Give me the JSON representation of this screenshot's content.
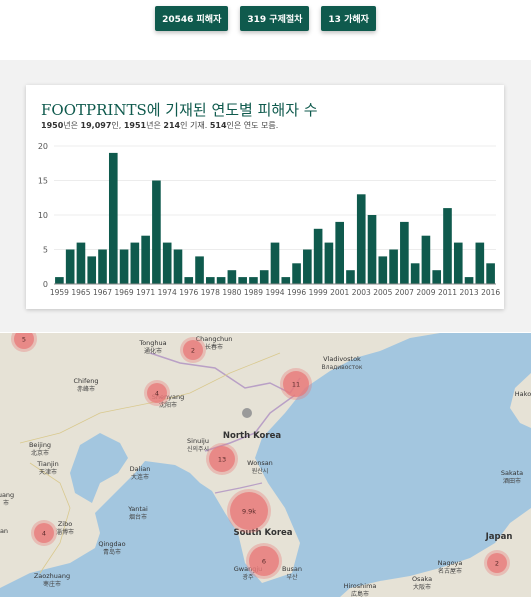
{
  "buttons": [
    {
      "label": "20546 피해자"
    },
    {
      "label": "319 구제절차"
    },
    {
      "label": "13 가해자"
    }
  ],
  "card": {
    "title": "FOOTPRINTS에 기재된 연도별 피해자 수",
    "subtitle": {
      "y1": "1950",
      "t1": "년은 ",
      "v1": "19,097",
      "t2": "인, ",
      "y2": "1951",
      "t3": "년은 ",
      "v2": "214",
      "t4": "인 기재. ",
      "v3": "514",
      "t5": "인은 연도 모름."
    }
  },
  "chart_data": {
    "type": "bar",
    "color": "#0f5a4d",
    "ylim": [
      0,
      20
    ],
    "yticks": [
      0,
      5,
      10,
      15,
      20
    ],
    "x_tick_labels": [
      "1959",
      "1965",
      "1967",
      "1969",
      "1971",
      "1974",
      "1976",
      "1978",
      "1980",
      "1989",
      "1994",
      "1996",
      "1999",
      "2001",
      "2003",
      "2005",
      "2007",
      "2009",
      "2011",
      "2013",
      "2016"
    ],
    "values": [
      1,
      5,
      6,
      4,
      5,
      19,
      5,
      6,
      7,
      15,
      6,
      5,
      1,
      4,
      1,
      1,
      2,
      1,
      1,
      2,
      6,
      1,
      3,
      5,
      8,
      6,
      9,
      2,
      13,
      10,
      4,
      5,
      9,
      3,
      7,
      2,
      11,
      6,
      1,
      6,
      3
    ]
  },
  "map": {
    "labels": [
      {
        "text": "Tonghua",
        "sub": "通化市"
      },
      {
        "text": "Changchun",
        "sub": "长春市"
      },
      {
        "text": "Vladivostok",
        "sub": "Владивосток"
      },
      {
        "text": "Chifeng",
        "sub": "赤峰市"
      },
      {
        "text": "Shenyang",
        "sub": "沈阳市"
      },
      {
        "text": "Beijing",
        "sub": "北京市"
      },
      {
        "text": "Tianjin",
        "sub": "天津市"
      },
      {
        "text": "Dalian",
        "sub": "大连市"
      },
      {
        "text": "Sinuiju",
        "sub": "신의주시"
      },
      {
        "text": "North Korea",
        "sub": ""
      },
      {
        "text": "Wonsan",
        "sub": "원산시"
      },
      {
        "text": "Zibo",
        "sub": "淄博市"
      },
      {
        "text": "Yantai",
        "sub": "烟台市"
      },
      {
        "text": "Qingdao",
        "sub": "青岛市"
      },
      {
        "text": "South Korea",
        "sub": ""
      },
      {
        "text": "Gwangju",
        "sub": "광주"
      },
      {
        "text": "Busan",
        "sub": "부산"
      },
      {
        "text": "Zaozhuang",
        "sub": "枣庄市"
      },
      {
        "text": "Hiroshima",
        "sub": "広島市"
      },
      {
        "text": "Osaka",
        "sub": "大阪市"
      },
      {
        "text": "Nagoya",
        "sub": "名古屋市"
      },
      {
        "text": "Japan",
        "sub": ""
      },
      {
        "text": "Sakata",
        "sub": "酒田市"
      },
      {
        "text": "Hako",
        "sub": ""
      },
      {
        "text": "uang",
        "sub": "市"
      },
      {
        "text": "an",
        "sub": ""
      }
    ],
    "clusters": [
      {
        "label": "5"
      },
      {
        "label": "2"
      },
      {
        "label": "11"
      },
      {
        "label": "4"
      },
      {
        "label": "13"
      },
      {
        "label": "9.9k"
      },
      {
        "label": "4"
      },
      {
        "label": "6"
      },
      {
        "label": "2"
      }
    ]
  }
}
